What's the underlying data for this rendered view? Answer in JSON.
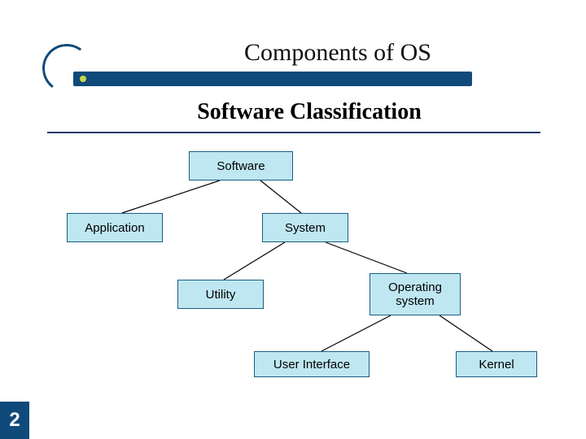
{
  "slide": {
    "title": "Components of OS",
    "subtitle": "Software Classification",
    "page_number": "2"
  },
  "nodes": {
    "software": "Software",
    "application": "Application",
    "system": "System",
    "utility": "Utility",
    "os": "Operating system",
    "ui": "User Interface",
    "kernel": "Kernel"
  },
  "chart_data": {
    "type": "tree",
    "title": "Software Classification",
    "root": "Software",
    "edges": [
      [
        "Software",
        "Application"
      ],
      [
        "Software",
        "System"
      ],
      [
        "System",
        "Utility"
      ],
      [
        "System",
        "Operating system"
      ],
      [
        "Operating system",
        "User Interface"
      ],
      [
        "Operating system",
        "Kernel"
      ]
    ]
  }
}
